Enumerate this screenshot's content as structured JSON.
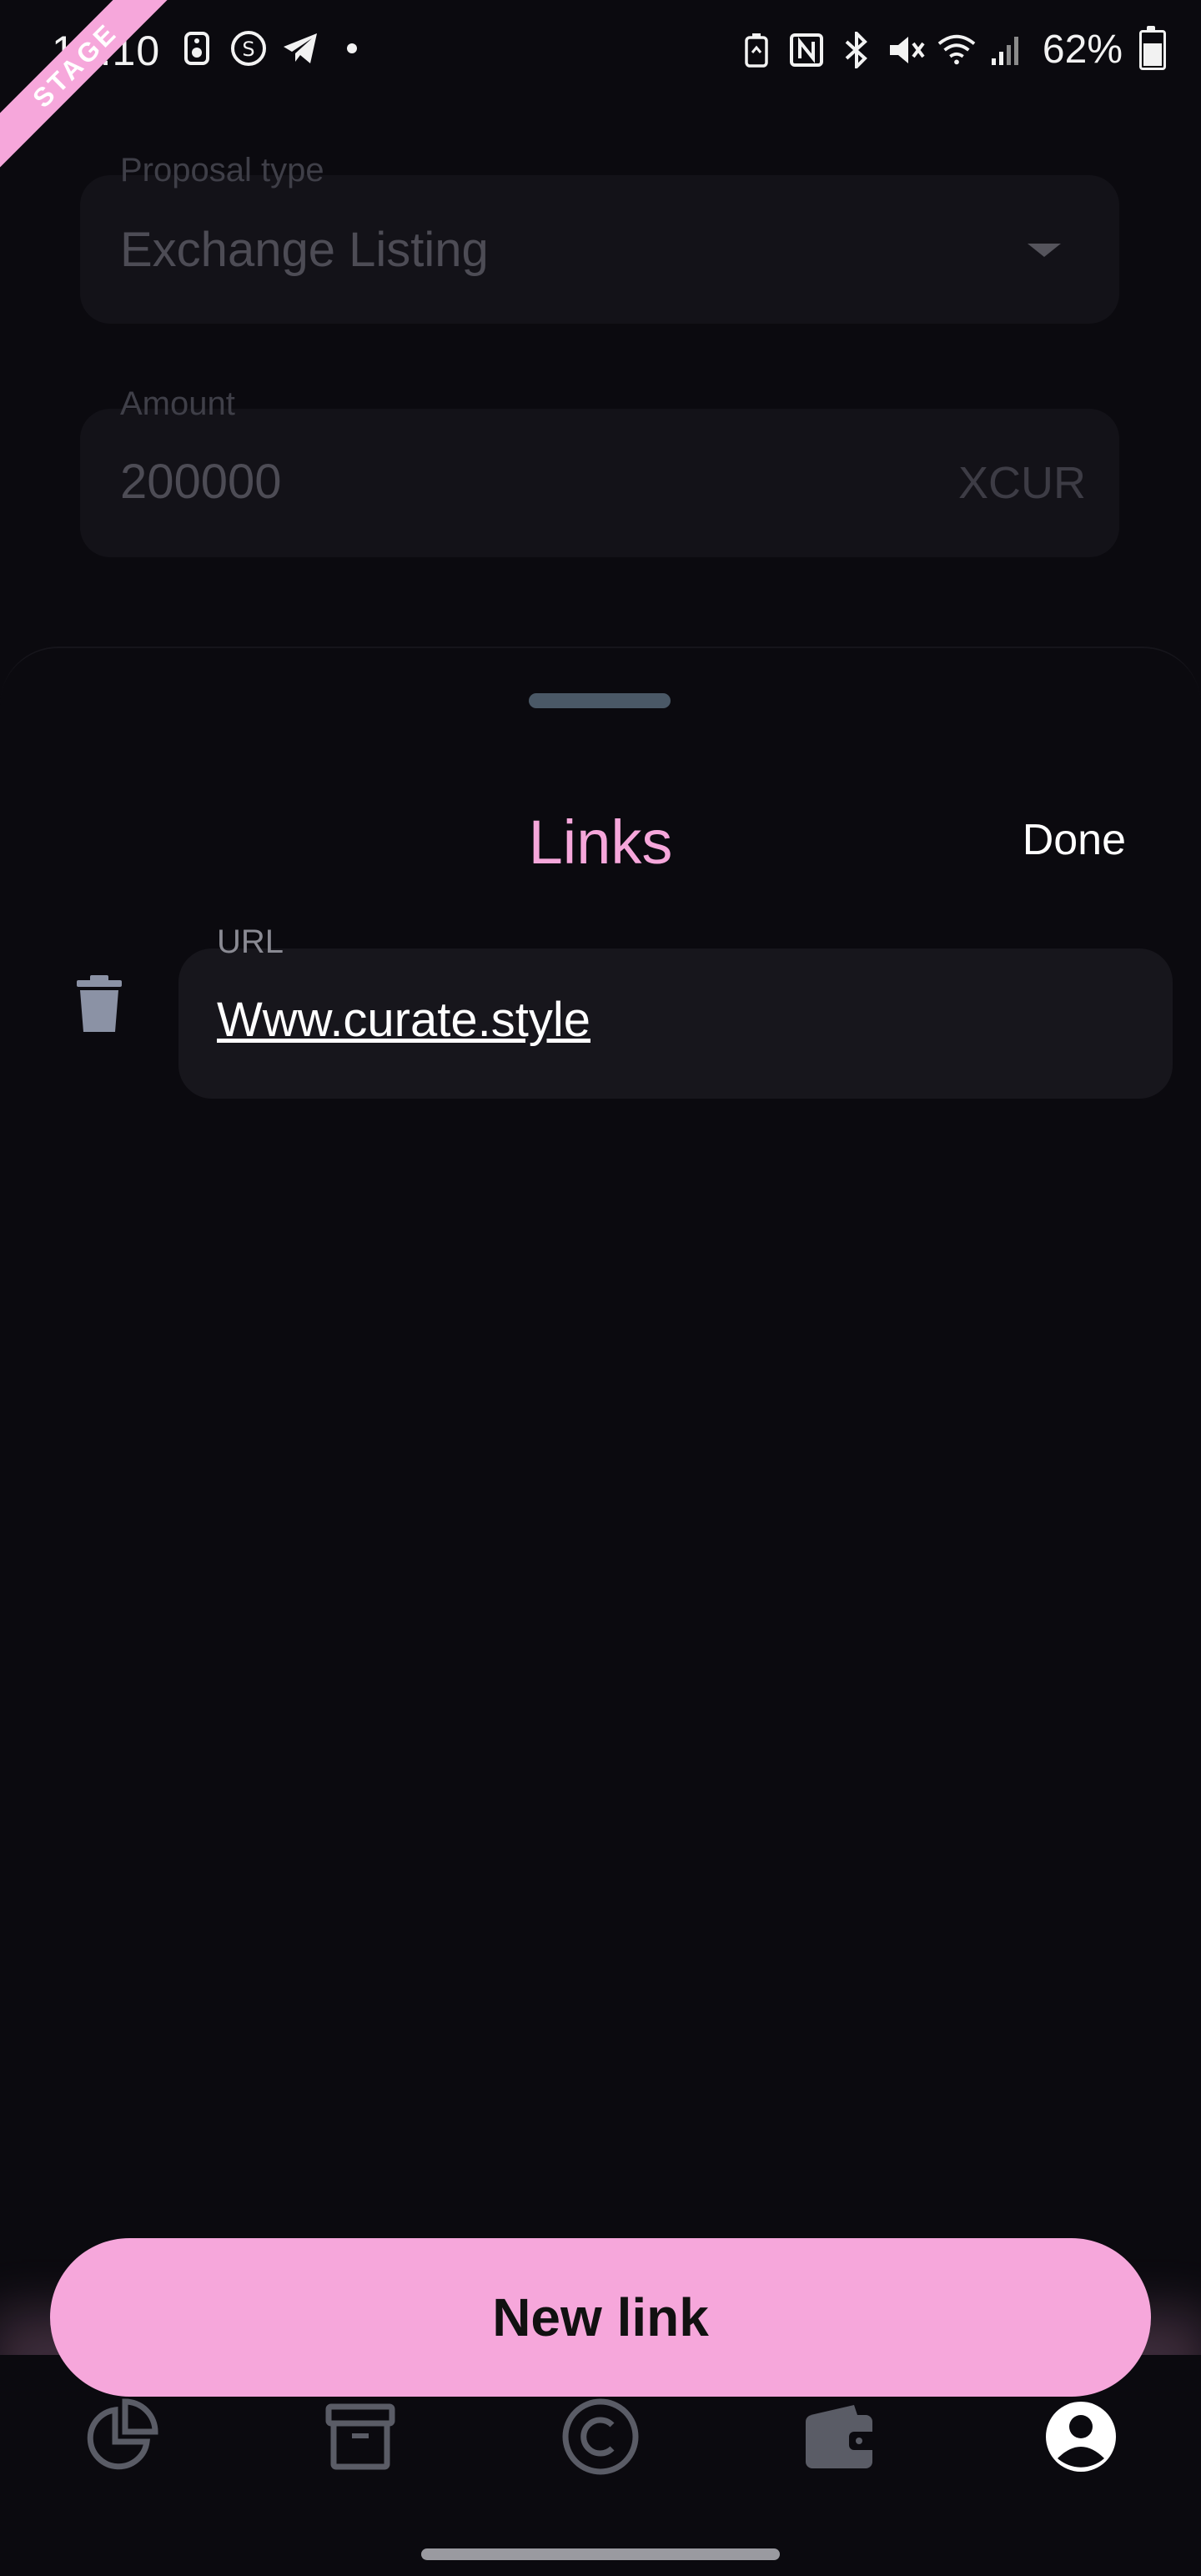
{
  "status_bar": {
    "time": "14:10",
    "battery_percent": "62%",
    "left_icons": [
      "speaker-icon",
      "s-app-icon",
      "telegram-icon",
      "dot-icon"
    ],
    "right_icons": [
      "battery-saver-icon",
      "nfc-icon",
      "bluetooth-icon",
      "mute-icon",
      "wifi-icon",
      "signal-icon"
    ]
  },
  "stage_ribbon": "STAGE",
  "background_form": {
    "proposal_type": {
      "label": "Proposal type",
      "value": "Exchange Listing"
    },
    "amount": {
      "label": "Amount",
      "value": "200000",
      "suffix": "XCUR"
    }
  },
  "sheet": {
    "title": "Links",
    "done_label": "Done",
    "links": [
      {
        "label": "URL",
        "value": "Www.curate.style"
      }
    ],
    "new_link_label": "New link"
  },
  "bottom_nav": {
    "items": [
      "pie-chart-icon",
      "archive-icon",
      "copyright-icon",
      "wallet-icon",
      "profile-icon"
    ],
    "active": "profile-icon"
  },
  "colors": {
    "accent": "#f6a7db",
    "background": "#0b0a0f",
    "field": "#17161c"
  }
}
